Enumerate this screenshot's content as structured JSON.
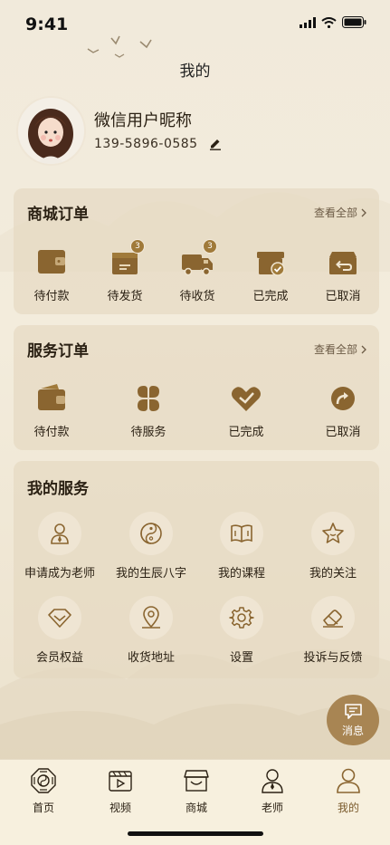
{
  "status": {
    "time": "9:41"
  },
  "header": {
    "title": "我的"
  },
  "profile": {
    "nickname": "微信用户昵称",
    "phone": "139-5896-0585"
  },
  "shop_orders": {
    "title": "商城订单",
    "view_all": "查看全部",
    "items": [
      {
        "label": "待付款",
        "icon": "wallet-icon",
        "badge": ""
      },
      {
        "label": "待发货",
        "icon": "package-icon",
        "badge": "3"
      },
      {
        "label": "待收货",
        "icon": "delivery-truck-icon",
        "badge": "3"
      },
      {
        "label": "已完成",
        "icon": "box-check-icon",
        "badge": ""
      },
      {
        "label": "已取消",
        "icon": "box-return-icon",
        "badge": ""
      }
    ]
  },
  "service_orders": {
    "title": "服务订单",
    "view_all": "查看全部",
    "items": [
      {
        "label": "待付款",
        "icon": "wallet-icon"
      },
      {
        "label": "待服务",
        "icon": "four-leaf-icon"
      },
      {
        "label": "已完成",
        "icon": "heart-check-icon"
      },
      {
        "label": "已取消",
        "icon": "redo-icon"
      }
    ]
  },
  "my_services": {
    "title": "我的服务",
    "items": [
      {
        "label": "申请成为老师",
        "icon": "teacher-icon"
      },
      {
        "label": "我的生辰八字",
        "icon": "yin-yang-icon"
      },
      {
        "label": "我的课程",
        "icon": "book-icon"
      },
      {
        "label": "我的关注",
        "icon": "star-icon"
      },
      {
        "label": "会员权益",
        "icon": "diamond-icon"
      },
      {
        "label": "收货地址",
        "icon": "location-pin-icon"
      },
      {
        "label": "设置",
        "icon": "gear-icon"
      },
      {
        "label": "投诉与反馈",
        "icon": "eraser-icon"
      }
    ]
  },
  "message_button": {
    "label": "消息"
  },
  "tabbar": {
    "items": [
      {
        "label": "首页",
        "icon": "bagua-icon"
      },
      {
        "label": "视频",
        "icon": "video-icon"
      },
      {
        "label": "商城",
        "icon": "shop-icon"
      },
      {
        "label": "老师",
        "icon": "teacher-icon"
      },
      {
        "label": "我的",
        "icon": "person-icon"
      }
    ],
    "active": "我的"
  },
  "colors": {
    "accent": "#a88553",
    "icon_brown": "#8a6530",
    "card_bg": "#e4d6be",
    "background": "#f1eadb"
  }
}
